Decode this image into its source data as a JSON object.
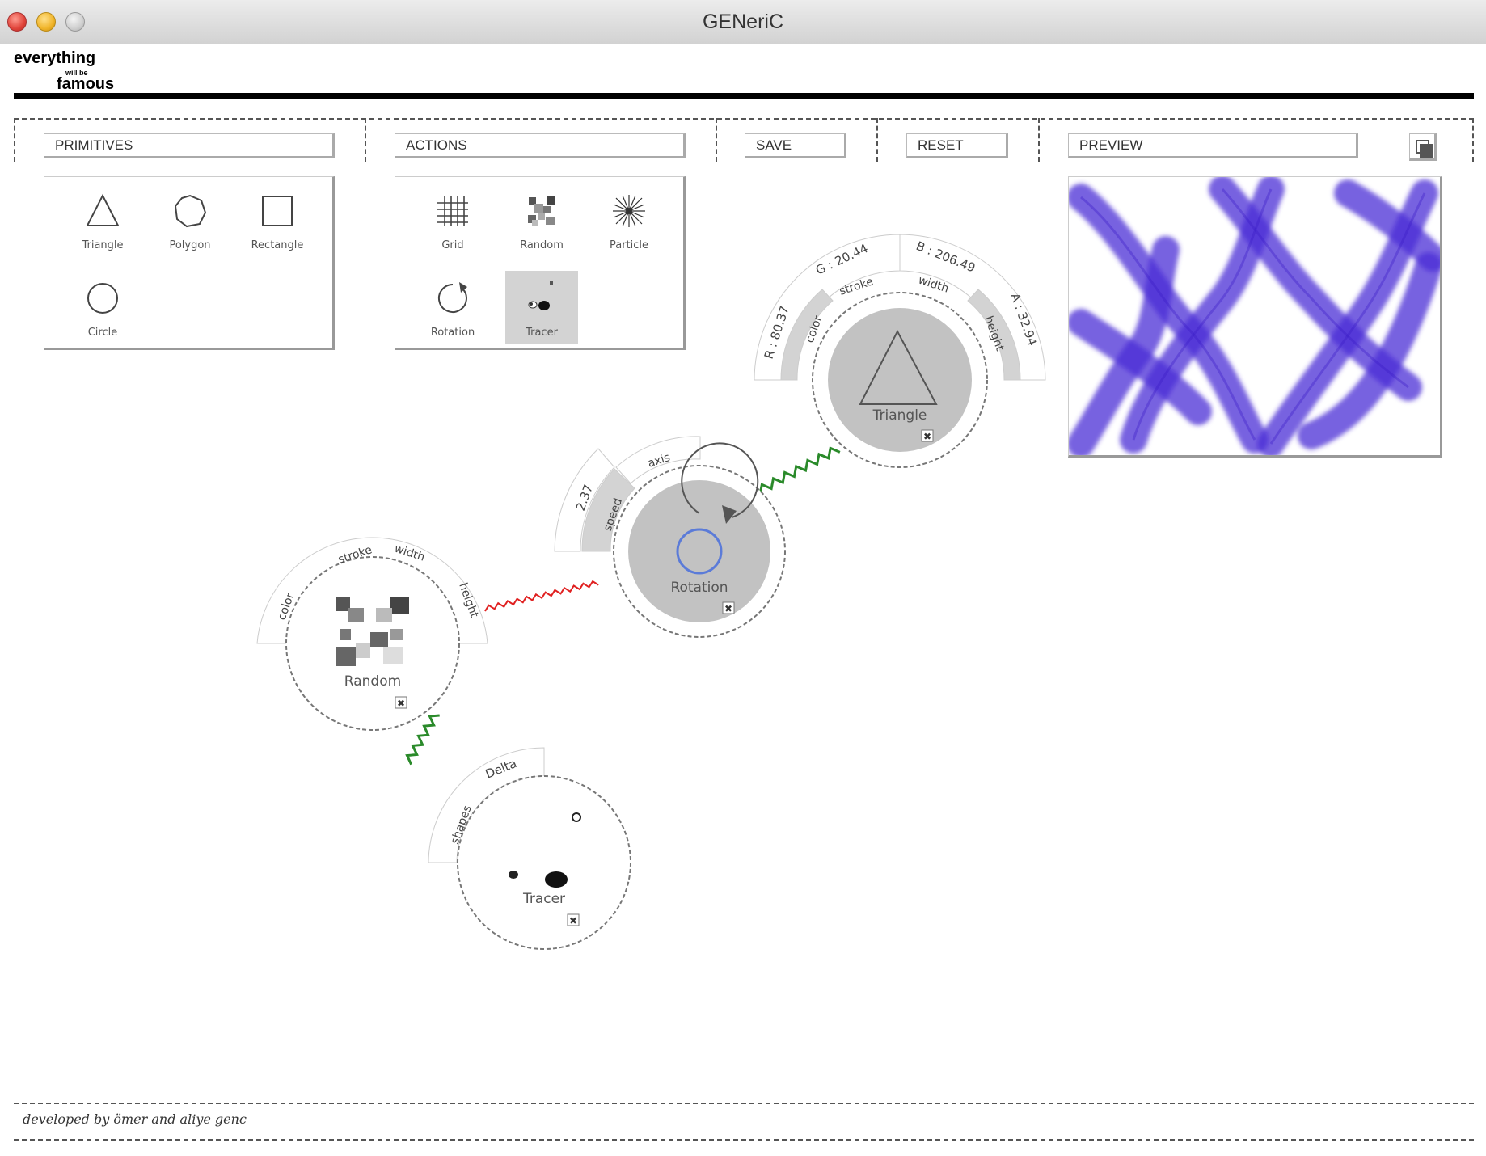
{
  "window": {
    "title": "GENeriC"
  },
  "logo": {
    "line1": "everything",
    "line2": "will be",
    "line3": "famous"
  },
  "toolbar": {
    "primitives_label": "PRIMITIVES",
    "actions_label": "ACTIONS",
    "save_label": "SAVE",
    "reset_label": "RESET",
    "preview_label": "PREVIEW"
  },
  "primitives": [
    {
      "label": "Triangle",
      "icon": "triangle-icon"
    },
    {
      "label": "Polygon",
      "icon": "polygon-icon"
    },
    {
      "label": "Rectangle",
      "icon": "rectangle-icon"
    },
    {
      "label": "Circle",
      "icon": "circle-icon"
    }
  ],
  "actions": [
    {
      "label": "Grid",
      "icon": "grid-icon"
    },
    {
      "label": "Random",
      "icon": "random-icon"
    },
    {
      "label": "Particle",
      "icon": "particle-icon"
    },
    {
      "label": "Rotation",
      "icon": "rotation-icon"
    },
    {
      "label": "Tracer",
      "icon": "tracer-icon",
      "selected": true
    }
  ],
  "nodes": {
    "triangle": {
      "label": "Triangle",
      "params": {
        "color": "color",
        "stroke": "stroke",
        "width": "width",
        "height": "height"
      },
      "values": {
        "r": "R : 80.37",
        "g": "G : 20.44",
        "b": "B : 206.49",
        "a": "A : 32.94"
      }
    },
    "rotation": {
      "label": "Rotation",
      "params": {
        "speed": "speed",
        "axis": "axis"
      },
      "values": {
        "speed": "2.37"
      }
    },
    "random": {
      "label": "Random",
      "params": {
        "color": "color",
        "stroke": "stroke",
        "width": "width",
        "height": "height"
      }
    },
    "tracer": {
      "label": "Tracer",
      "params": {
        "shapes": "shapes",
        "delta": "Delta"
      }
    }
  },
  "footer": {
    "credit": "developed by ömer and aliye genc"
  },
  "colors": {
    "preview_stroke": "#4a2bd6",
    "link_green": "#2a8a2a",
    "link_red": "#e02020",
    "node_fill": "#c2c2c2"
  }
}
